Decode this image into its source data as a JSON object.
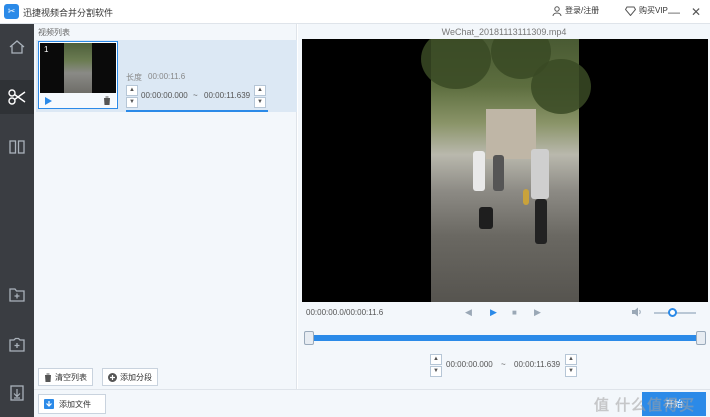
{
  "app": {
    "title": "迅捷视频合并分割软件",
    "login_label": "登录/注册",
    "vip_label": "购买VIP"
  },
  "window_controls": [
    "minimize",
    "close"
  ],
  "sidebar": {
    "items": [
      {
        "icon": "home-icon"
      },
      {
        "icon": "scissors-icon",
        "active": true
      },
      {
        "icon": "merge-icon"
      },
      {
        "icon": "add-folder-icon"
      },
      {
        "icon": "add-media-icon"
      },
      {
        "icon": "download-icon"
      }
    ]
  },
  "list": {
    "header": "视频列表",
    "items": [
      {
        "index": "1",
        "duration_label": "长度",
        "duration": "00:00:11.6",
        "start": "00:00:00.000",
        "end": "00:00:11.639",
        "separator": "~"
      }
    ],
    "clear_label": "清空列表",
    "add_segment_label": "添加分段"
  },
  "bottom": {
    "add_file_label": "添加文件",
    "start_label": "开始",
    "watermark": "值 什么值得买"
  },
  "player": {
    "file_name": "WeChat_20181113111309.mp4",
    "time_readout": "00:00:00.0/00:00:11.6",
    "trim_start": "00:00:00.000",
    "trim_end": "00:00:11.639",
    "trim_separator": "~",
    "volume_level": 0.45
  },
  "colors": {
    "accent": "#2b8ae8",
    "sidebar": "#3a3d42",
    "panel": "#f3f7fb"
  }
}
